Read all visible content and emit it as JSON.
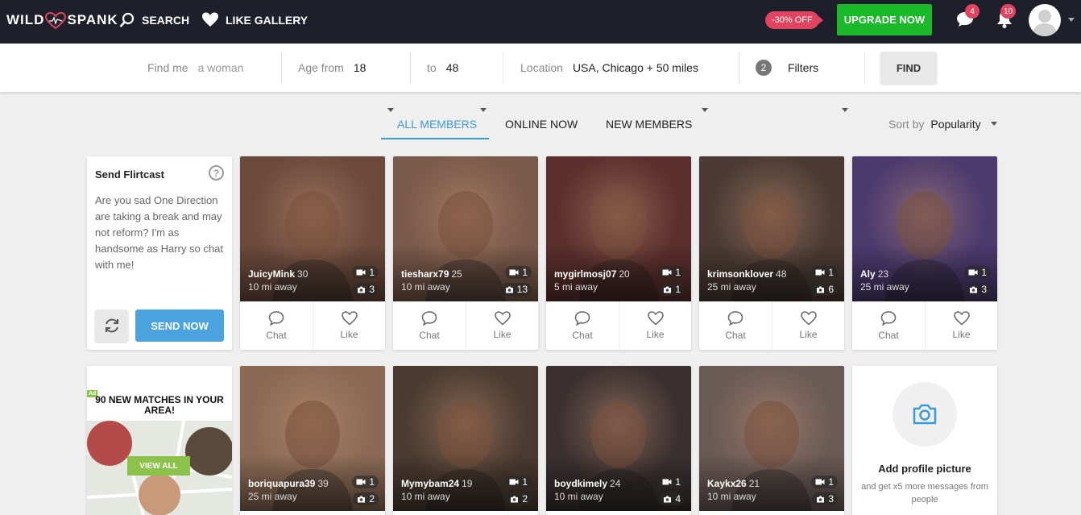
{
  "brand": {
    "logo_left": "WILD",
    "logo_right": "SPANK"
  },
  "nav": {
    "search_label": "SEARCH",
    "like_gallery_label": "LIKE GALLERY",
    "promo": "-30% OFF",
    "upgrade_label": "UPGRADE NOW",
    "messages_count": "4",
    "notifications_count": "10"
  },
  "filters": {
    "find_me_label": "Find me",
    "find_me_value": "a woman",
    "age_from_label": "Age from",
    "age_from_value": "18",
    "age_to_label": "to",
    "age_to_value": "48",
    "location_label": "Location",
    "location_value": "USA, Chicago + 50 miles",
    "filters_count": "2",
    "filters_label": "Filters",
    "find_button": "FIND"
  },
  "tabs": [
    {
      "label": "ALL MEMBERS"
    },
    {
      "label": "ONLINE NOW"
    },
    {
      "label": "NEW MEMBERS"
    }
  ],
  "sort": {
    "label": "Sort by",
    "value": "Popularity"
  },
  "flirtcast": {
    "title": "Send Flirtcast",
    "help": "?",
    "message": "Are you sad One Direction are taking a break and may not reform? I'm as handsome as Harry so chat with me!",
    "send_label": "SEND NOW"
  },
  "ad": {
    "tag": "Ad",
    "title": "90 NEW MATCHES IN YOUR AREA!",
    "button": "VIEW ALL"
  },
  "add_photo": {
    "title": "Add profile picture",
    "subtitle": "and get x5 more messages from people"
  },
  "actions": {
    "chat": "Chat",
    "like": "Like"
  },
  "members": [
    {
      "name": "JuicyMink",
      "age": "30",
      "distance": "10 mi away",
      "videos": "1",
      "photos": "3",
      "bg": "#6b4a3c"
    },
    {
      "name": "tiesharx79",
      "age": "25",
      "distance": "10 mi away",
      "videos": "1",
      "photos": "13",
      "bg": "#7a5a4a"
    },
    {
      "name": "mygirlmosj07",
      "age": "20",
      "distance": "5 mi away",
      "videos": "1",
      "photos": "1",
      "bg": "#5a2f2c"
    },
    {
      "name": "krimsonklover",
      "age": "48",
      "distance": "25 mi away",
      "videos": "1",
      "photos": "6",
      "bg": "#4a3a33"
    },
    {
      "name": "Aly",
      "age": "23",
      "distance": "25 mi away",
      "videos": "1",
      "photos": "3",
      "bg": "#4b3a6e"
    },
    {
      "name": "boriquapura39",
      "age": "39",
      "distance": "25 mi away",
      "videos": "1",
      "photos": "2",
      "bg": "#8a6a55"
    },
    {
      "name": "Mymybam24",
      "age": "19",
      "distance": "10 mi away",
      "videos": "1",
      "photos": "2",
      "bg": "#4a3a30"
    },
    {
      "name": "boydkimely",
      "age": "24",
      "distance": "10 mi away",
      "videos": "1",
      "photos": "4",
      "bg": "#3a3030"
    },
    {
      "name": "Kaykx26",
      "age": "21",
      "distance": "10 mi away",
      "videos": "1",
      "photos": "3",
      "bg": "#6a5a55"
    }
  ]
}
